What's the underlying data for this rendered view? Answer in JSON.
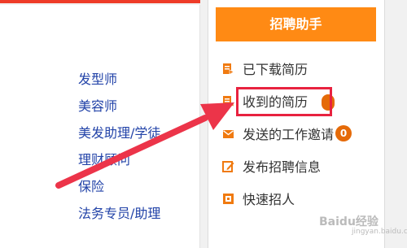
{
  "left_panel": {
    "jobs": [
      "发型师",
      "美容师",
      "美发助理/学徒",
      "理财顾问",
      "保险",
      "法务专员/助理"
    ]
  },
  "right_panel": {
    "title": "招聘助手",
    "menu": [
      {
        "label": "已下载简历",
        "icon": "download-resume-icon"
      },
      {
        "label": "收到的简历",
        "icon": "received-resume-icon"
      },
      {
        "label": "发送的工作邀请",
        "icon": "envelope-icon",
        "badge": "0"
      },
      {
        "label": "发布招聘信息",
        "icon": "edit-icon"
      },
      {
        "label": "快速招人",
        "icon": "quick-hire-icon"
      }
    ]
  },
  "watermark": {
    "text": "Baidu经验",
    "sub": "jingyan.baidu.com"
  },
  "colors": {
    "accent": "#ff8a14",
    "highlight": "#e8223f",
    "link": "#2243a8",
    "badge": "#e56a08"
  }
}
